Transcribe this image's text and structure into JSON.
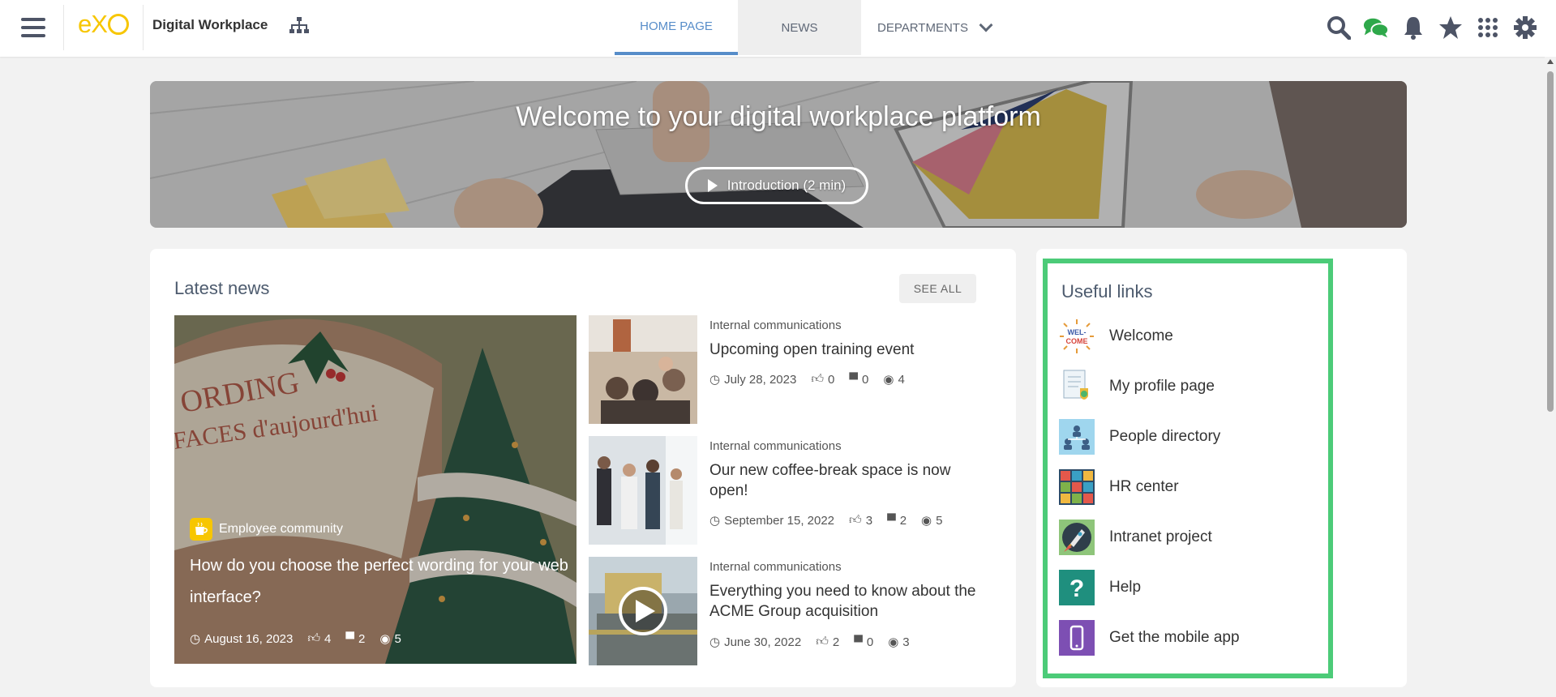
{
  "header": {
    "site_name": "Digital Workplace",
    "logo_text": "eXo",
    "nav": [
      {
        "label": "HOME PAGE",
        "active": true
      },
      {
        "label": "NEWS",
        "active": false
      },
      {
        "label": "DEPARTMENTS",
        "active": false
      }
    ],
    "icons": [
      "menu-icon",
      "site-map-icon",
      "search-icon",
      "chat-icon",
      "bell-icon",
      "star-icon",
      "apps-grid-icon",
      "gear-icon"
    ]
  },
  "banner": {
    "title": "Welcome to your digital workplace platform",
    "button_label": "Introduction (2 min)"
  },
  "news": {
    "title": "Latest news",
    "see_all": "SEE ALL",
    "featured": {
      "category": "Employee community",
      "headline": "How do you choose the perfect wording for your web interface?",
      "date": "August 16, 2023",
      "likes": "4",
      "comments": "2",
      "views": "5",
      "image_text_1": "ORDING",
      "image_text_2": "FACES d'aujourd'hui"
    },
    "stories": [
      {
        "category": "Internal communications",
        "headline": "Upcoming open training event",
        "date": "July 28, 2023",
        "likes": "0",
        "comments": "0",
        "views": "4"
      },
      {
        "category": "Internal communications",
        "headline": "Our new coffee-break space is now open!",
        "date": "September 15, 2022",
        "likes": "3",
        "comments": "2",
        "views": "5"
      },
      {
        "category": "Internal communications",
        "headline": "Everything you need to know about the ACME Group acquisition",
        "date": "June 30, 2022",
        "likes": "2",
        "comments": "0",
        "views": "3"
      }
    ]
  },
  "links": {
    "title": "Useful links",
    "items": [
      {
        "label": "Welcome",
        "icon": "welcome-icon",
        "icon_text": "WEL-COME"
      },
      {
        "label": "My profile page",
        "icon": "profile-icon"
      },
      {
        "label": "People directory",
        "icon": "people-directory-icon"
      },
      {
        "label": "HR center",
        "icon": "hr-center-icon"
      },
      {
        "label": "Intranet project",
        "icon": "rocket-icon"
      },
      {
        "label": "Help",
        "icon": "help-icon",
        "icon_text": "?"
      },
      {
        "label": "Get the mobile app",
        "icon": "mobile-icon"
      }
    ],
    "highlight_color": "#4ccb78"
  },
  "colors": {
    "accent": "#578dc9",
    "logo": "#f7c600",
    "chat": "#2ea84a"
  }
}
